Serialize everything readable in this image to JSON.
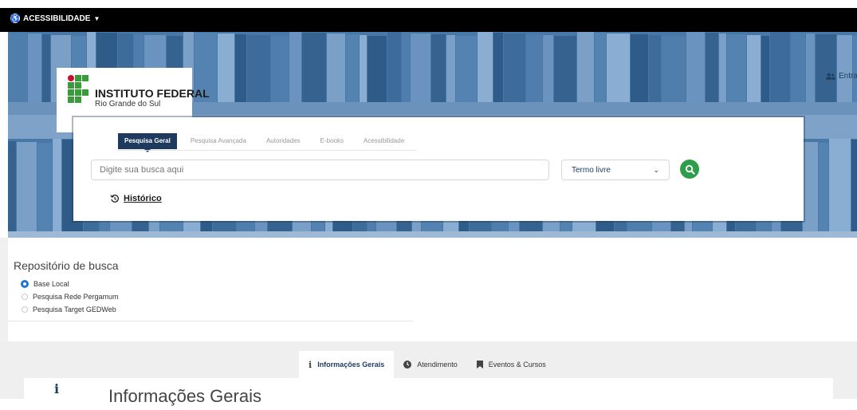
{
  "topbar": {
    "accessibility_label": "ACESSIBILIDADE",
    "accessibility_icon": "accessibility-icon"
  },
  "logo": {
    "title": "INSTITUTO FEDERAL",
    "subtitle": "Rio Grande do Sul"
  },
  "login": {
    "label": "Entrar",
    "icon": "user-icon"
  },
  "search": {
    "tabs": [
      {
        "label": "Pesquisa Geral",
        "active": true
      },
      {
        "label": "Pesquisa Avançada"
      },
      {
        "label": "Autoridades"
      },
      {
        "label": "E-books"
      },
      {
        "label": "Acessibilidade"
      }
    ],
    "placeholder": "Digite sua busca aqui",
    "select_value": "Termo livre",
    "search_icon": "search-icon",
    "history_label": "Histórico"
  },
  "repository": {
    "title": "Repositório de busca",
    "options": [
      {
        "label": "Base Local",
        "checked": true
      },
      {
        "label": "Pesquisa Rede Pergamum",
        "checked": false
      },
      {
        "label": "Pesquisa Target GEDWeb",
        "checked": false
      }
    ]
  },
  "info": {
    "tabs": [
      {
        "label": "Informações Gerais",
        "icon": "info-icon",
        "active": true
      },
      {
        "label": "Atendimento",
        "icon": "clock-icon"
      },
      {
        "label": "Eventos & Cursos",
        "icon": "bookmark-icon"
      }
    ],
    "panel_title": "Informações Gerais"
  },
  "colors": {
    "primary": "#1e3a5f",
    "accent_green": "#2e9e4a",
    "banner": "#3e6d9c",
    "radio_checked": "#1976d2"
  }
}
